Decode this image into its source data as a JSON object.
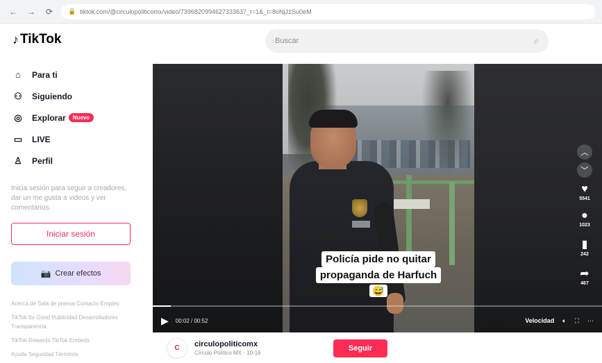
{
  "browser": {
    "back": "←",
    "forward": "→",
    "reload": "⟳",
    "url": "tiktok.com/@circulopoliticomx/video/7396820994627333637_r=1&_t=8oNjJ1Su0eM"
  },
  "header": {
    "logo_text": "TikTok",
    "search_placeholder": "Buscar"
  },
  "sidebar": {
    "items": [
      {
        "label": "Para ti",
        "icon": "home-icon"
      },
      {
        "label": "Siguiendo",
        "icon": "following-icon"
      },
      {
        "label": "Explorar",
        "icon": "compass-icon",
        "badge": "Nuevo"
      },
      {
        "label": "LIVE",
        "icon": "live-icon"
      },
      {
        "label": "Perfil",
        "icon": "profile-icon"
      }
    ],
    "login_hint": "Inicia sesión para seguir a creadores, dar un me gusta a videos y ver comentarios.",
    "login_button": "Iniciar sesión",
    "effects_button": "Crear efectos",
    "footer": [
      "Acerca de  Sala de prensa  Contacto  Empleo",
      "TikTok for Good  Publicidad  Desarrolladores  Transparencia",
      "TikTok Rewards  TikTok Embeds",
      "Ayuda  Seguridad  Términos"
    ]
  },
  "video": {
    "caption_line1": "Policía pide no quitar",
    "caption_line2": "propaganda de Harfuch",
    "caption_emoji": "😅",
    "time": "00:02 / 00:52",
    "speed_label": "Velocidad",
    "progress_fraction": 0.04,
    "actions": [
      {
        "icon": "heart-icon",
        "count": "5541"
      },
      {
        "icon": "comment-icon",
        "count": "1023"
      },
      {
        "icon": "bookmark-icon",
        "count": "242"
      },
      {
        "icon": "share-icon",
        "count": "467"
      }
    ]
  },
  "account": {
    "avatar_letter": "C",
    "name": "circulopoliticomx",
    "subtitle": "Círculo Político MX · 10-16",
    "follow_button": "Seguir"
  },
  "colors": {
    "brand_pink": "#fe2c55",
    "text_dark": "#161823"
  }
}
